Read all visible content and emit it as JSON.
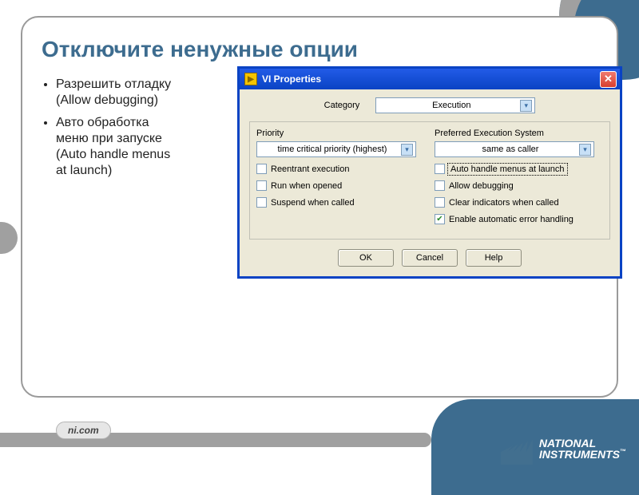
{
  "slide": {
    "title": "Отключите ненужные опции",
    "bullets": [
      "Разрешить отладку (Allow debugging)",
      "Авто обработка меню при запуске (Auto handle menus at launch)"
    ]
  },
  "window": {
    "title": "VI Properties",
    "category_label": "Category",
    "category_value": "Execution",
    "priority_label": "Priority",
    "priority_value": "time critical priority (highest)",
    "pes_label": "Preferred Execution System",
    "pes_value": "same as caller",
    "checks_left": [
      {
        "label": "Reentrant execution",
        "checked": false
      },
      {
        "label": "Run when opened",
        "checked": false
      },
      {
        "label": "Suspend when called",
        "checked": false
      }
    ],
    "checks_right": [
      {
        "label": "Auto handle menus at launch",
        "checked": false,
        "focused": true
      },
      {
        "label": "Allow debugging",
        "checked": false
      },
      {
        "label": "Clear indicators when called",
        "checked": false
      },
      {
        "label": "Enable automatic error handling",
        "checked": true
      }
    ],
    "buttons": {
      "ok": "OK",
      "cancel": "Cancel",
      "help": "Help"
    }
  },
  "footer": {
    "site": "ni.com",
    "brand1": "NATIONAL",
    "brand2": "INSTRUMENTS",
    "tm": "™"
  }
}
